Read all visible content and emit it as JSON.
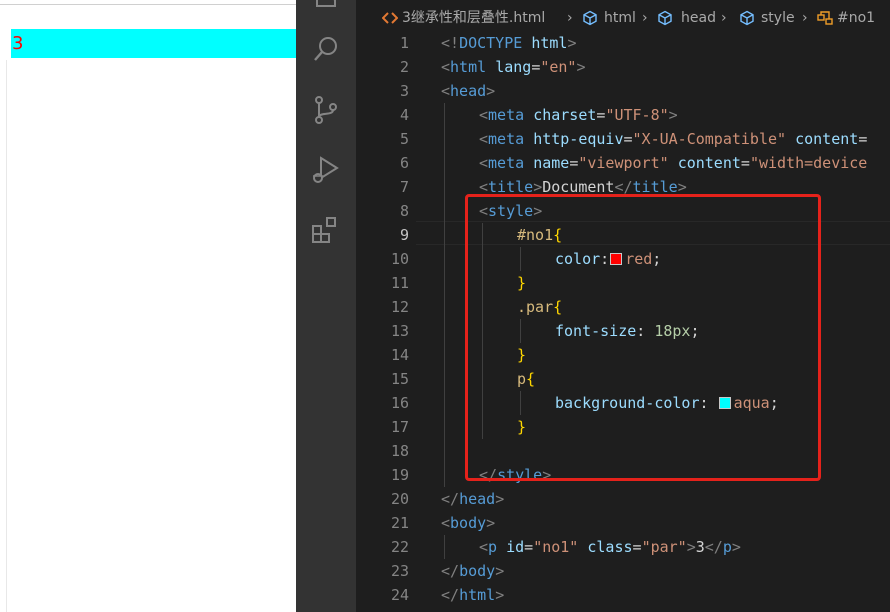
{
  "preview": {
    "paragraph_text": "3"
  },
  "activity_bar": {
    "icons": [
      "explorer-icon",
      "search-icon",
      "source-control-icon",
      "run-debug-icon",
      "extensions-icon"
    ]
  },
  "breadcrumb": {
    "file": "3继承性和层叠性.html",
    "items": [
      "html",
      "head",
      "style",
      "#no1"
    ]
  },
  "editor": {
    "active_line": 9,
    "lines": [
      {
        "n": "1",
        "indent": 0,
        "tokens": [
          [
            "brk",
            "<!"
          ],
          [
            "tag",
            "DOCTYPE"
          ],
          [
            "txt",
            " "
          ],
          [
            "attr",
            "html"
          ],
          [
            "brk",
            ">"
          ]
        ]
      },
      {
        "n": "2",
        "indent": 0,
        "tokens": [
          [
            "brk",
            "<"
          ],
          [
            "tag",
            "html"
          ],
          [
            "txt",
            " "
          ],
          [
            "attr",
            "lang"
          ],
          [
            "txt",
            "="
          ],
          [
            "str",
            "\"en\""
          ],
          [
            "brk",
            ">"
          ]
        ]
      },
      {
        "n": "3",
        "indent": 0,
        "tokens": [
          [
            "brk",
            "<"
          ],
          [
            "tag",
            "head"
          ],
          [
            "brk",
            ">"
          ]
        ]
      },
      {
        "n": "4",
        "indent": 1,
        "tokens": [
          [
            "brk",
            "<"
          ],
          [
            "tag",
            "meta"
          ],
          [
            "txt",
            " "
          ],
          [
            "attr",
            "charset"
          ],
          [
            "txt",
            "="
          ],
          [
            "str",
            "\"UTF-8\""
          ],
          [
            "brk",
            ">"
          ]
        ]
      },
      {
        "n": "5",
        "indent": 1,
        "tokens": [
          [
            "brk",
            "<"
          ],
          [
            "tag",
            "meta"
          ],
          [
            "txt",
            " "
          ],
          [
            "attr",
            "http-equiv"
          ],
          [
            "txt",
            "="
          ],
          [
            "str",
            "\"X-UA-Compatible\""
          ],
          [
            "txt",
            " "
          ],
          [
            "attr",
            "content"
          ],
          [
            "txt",
            "="
          ]
        ]
      },
      {
        "n": "6",
        "indent": 1,
        "tokens": [
          [
            "brk",
            "<"
          ],
          [
            "tag",
            "meta"
          ],
          [
            "txt",
            " "
          ],
          [
            "attr",
            "name"
          ],
          [
            "txt",
            "="
          ],
          [
            "str",
            "\"viewport\""
          ],
          [
            "txt",
            " "
          ],
          [
            "attr",
            "content"
          ],
          [
            "txt",
            "="
          ],
          [
            "str",
            "\"width=device"
          ]
        ]
      },
      {
        "n": "7",
        "indent": 1,
        "tokens": [
          [
            "brk",
            "<"
          ],
          [
            "tag",
            "title"
          ],
          [
            "brk",
            ">"
          ],
          [
            "txt",
            "Document"
          ],
          [
            "brk",
            "</"
          ],
          [
            "tag",
            "title"
          ],
          [
            "brk",
            ">"
          ]
        ]
      },
      {
        "n": "8",
        "indent": 1,
        "tokens": [
          [
            "brk",
            "<"
          ],
          [
            "tag",
            "style"
          ],
          [
            "brk",
            ">"
          ]
        ]
      },
      {
        "n": "9",
        "indent": 2,
        "tokens": [
          [
            "sel",
            "#no1"
          ],
          [
            "brace",
            "{"
          ]
        ]
      },
      {
        "n": "10",
        "indent": 3,
        "tokens": [
          [
            "attr",
            "color"
          ],
          [
            "txt",
            ":"
          ],
          [
            "swatch",
            "#ff0000"
          ],
          [
            "str",
            "red"
          ],
          [
            "txt",
            ";"
          ]
        ]
      },
      {
        "n": "11",
        "indent": 2,
        "tokens": [
          [
            "brace",
            "}"
          ]
        ]
      },
      {
        "n": "12",
        "indent": 2,
        "tokens": [
          [
            "sel",
            ".par"
          ],
          [
            "brace",
            "{"
          ]
        ]
      },
      {
        "n": "13",
        "indent": 3,
        "tokens": [
          [
            "attr",
            "font-size"
          ],
          [
            "txt",
            ": "
          ],
          [
            "num",
            "18px"
          ],
          [
            "txt",
            ";"
          ]
        ]
      },
      {
        "n": "14",
        "indent": 2,
        "tokens": [
          [
            "brace",
            "}"
          ]
        ]
      },
      {
        "n": "15",
        "indent": 2,
        "tokens": [
          [
            "sel",
            "p"
          ],
          [
            "brace",
            "{"
          ]
        ]
      },
      {
        "n": "16",
        "indent": 3,
        "tokens": [
          [
            "attr",
            "background-color"
          ],
          [
            "txt",
            ": "
          ],
          [
            "swatch",
            "#00ffff"
          ],
          [
            "str",
            "aqua"
          ],
          [
            "txt",
            ";"
          ]
        ]
      },
      {
        "n": "17",
        "indent": 2,
        "tokens": [
          [
            "brace",
            "}"
          ]
        ]
      },
      {
        "n": "18",
        "indent": 0,
        "tokens": []
      },
      {
        "n": "19",
        "indent": 1,
        "tokens": [
          [
            "brk",
            "</"
          ],
          [
            "tag",
            "style"
          ],
          [
            "brk",
            ">"
          ]
        ]
      },
      {
        "n": "20",
        "indent": 0,
        "tokens": [
          [
            "brk",
            "</"
          ],
          [
            "tag",
            "head"
          ],
          [
            "brk",
            ">"
          ]
        ]
      },
      {
        "n": "21",
        "indent": 0,
        "tokens": [
          [
            "brk",
            "<"
          ],
          [
            "tag",
            "body"
          ],
          [
            "brk",
            ">"
          ]
        ]
      },
      {
        "n": "22",
        "indent": 1,
        "tokens": [
          [
            "brk",
            "<"
          ],
          [
            "tag",
            "p"
          ],
          [
            "txt",
            " "
          ],
          [
            "attr",
            "id"
          ],
          [
            "txt",
            "="
          ],
          [
            "str",
            "\"no1\""
          ],
          [
            "txt",
            " "
          ],
          [
            "attr",
            "class"
          ],
          [
            "txt",
            "="
          ],
          [
            "str",
            "\"par\""
          ],
          [
            "brk",
            ">"
          ],
          [
            "txt",
            "3"
          ],
          [
            "brk",
            "</"
          ],
          [
            "tag",
            "p"
          ],
          [
            "brk",
            ">"
          ]
        ]
      },
      {
        "n": "23",
        "indent": 0,
        "tokens": [
          [
            "brk",
            "</"
          ],
          [
            "tag",
            "body"
          ],
          [
            "brk",
            ">"
          ]
        ]
      },
      {
        "n": "24",
        "indent": 0,
        "tokens": [
          [
            "brk",
            "</"
          ],
          [
            "tag",
            "html"
          ],
          [
            "brk",
            ">"
          ]
        ]
      }
    ]
  },
  "colors": {
    "highlight_box": "#e5221b",
    "preview_bg": "#00ffff",
    "preview_text": "#ff0000"
  }
}
